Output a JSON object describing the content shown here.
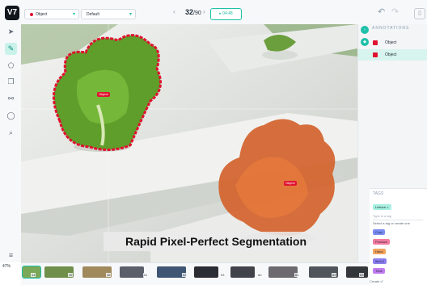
{
  "header": {
    "logo": "V7",
    "class_select": "Object",
    "view_select": "Default",
    "page_current": "32",
    "page_total": "/90",
    "timer": "04:48",
    "prev_icon": "chevron-left-icon",
    "next_icon": "chevron-right-icon"
  },
  "toolbar": {
    "tools": [
      "pointer-icon",
      "brush-icon",
      "polygon-icon",
      "copy-icon",
      "keypoint-icon",
      "shape-icon",
      "zoom-icon",
      "menu-icon"
    ],
    "zoom": "47%"
  },
  "canvas": {
    "object_tag_1": "Object",
    "object_tag_2": "Object",
    "caption": "Rapid Pixel-Perfect Segmentation"
  },
  "annotations": {
    "title": "ANNOTATIONS",
    "items": [
      {
        "label": "Object",
        "selected": false
      },
      {
        "label": "Object",
        "selected": true
      }
    ]
  },
  "tags": {
    "header": "TAGS",
    "chip": "Lettuce",
    "input_placeholder": "Type in a tag",
    "hint": "Select a tag or create one",
    "options": [
      {
        "label": "Crop",
        "color": "#7b8cf5"
      },
      {
        "label": "Produce",
        "color": "#f47ba0"
      },
      {
        "label": "Hand",
        "color": "#f5a35c"
      },
      {
        "label": "Item 2",
        "color": "#8b7ef0"
      },
      {
        "label": "Tube",
        "color": "#c07bf0"
      }
    ],
    "create_label": "Create"
  },
  "filmstrip": {
    "numbers": [
      "44",
      "45",
      "46",
      "51",
      "52",
      "53",
      "60",
      "61",
      "62",
      "63"
    ]
  },
  "colors": {
    "accent": "#1ec0a8",
    "mask_1": "#e0112f",
    "mask_2": "#ff5a1f"
  }
}
